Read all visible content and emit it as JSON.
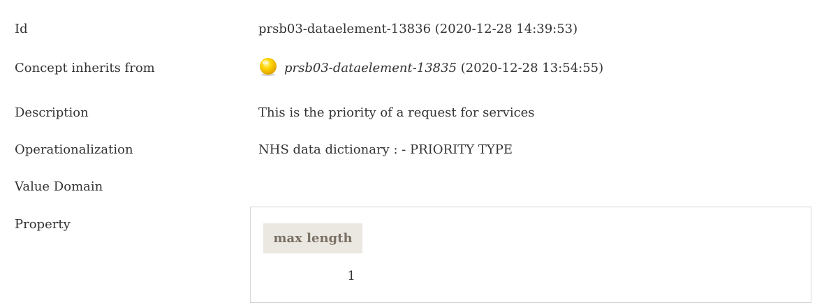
{
  "rows": {
    "id": {
      "label": "Id",
      "value": "prsb03-dataelement-13836 (2020-12-28 14:39:53)"
    },
    "inherits": {
      "label": "Concept inherits from",
      "link": "prsb03-dataelement-13835",
      "date": " (2020-12-28 13:54:55)",
      "icon": "yellow-orb-icon",
      "icon_color": "#f5c400"
    },
    "description": {
      "label": "Description",
      "value": "This is the priority of a request for services"
    },
    "operationalization": {
      "label": "Operationalization",
      "value": "NHS data dictionary : - PRIORITY TYPE"
    },
    "value_domain": {
      "label": "Value Domain"
    },
    "property": {
      "label": "Property",
      "header": "max length",
      "value": "1"
    }
  },
  "colors": {
    "text": "#333333",
    "header_bg": "#ebe8e2",
    "header_text": "#7a7065",
    "border": "#d4d4d4"
  }
}
